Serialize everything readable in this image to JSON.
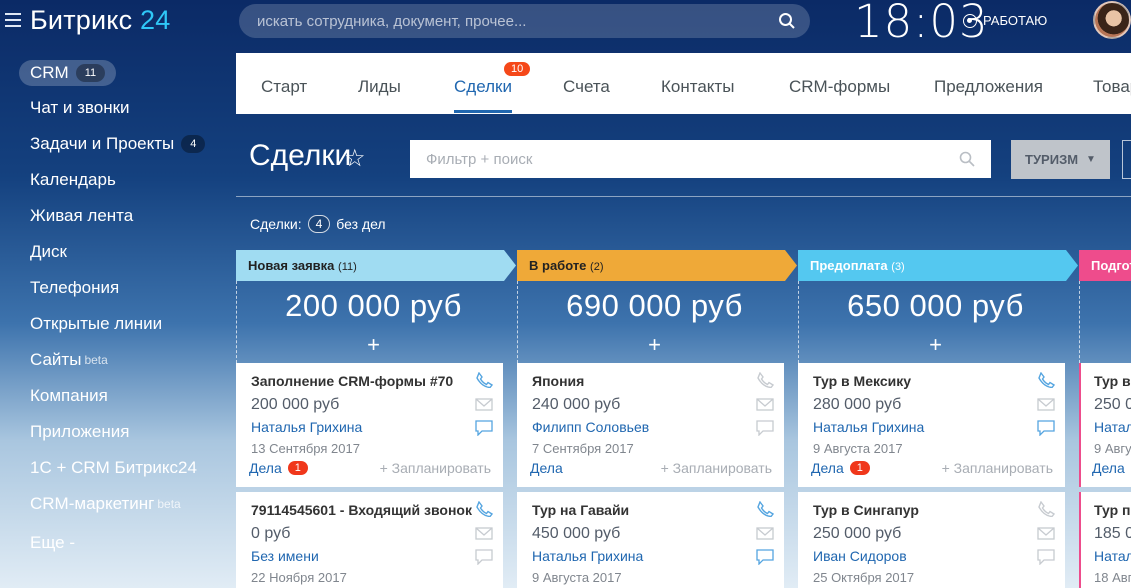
{
  "header": {
    "logo_text": "Битрикс",
    "logo_num": "24",
    "search_placeholder": "искать сотрудника, документ, прочее...",
    "clock": "18:03",
    "status": "РАБОТАЮ"
  },
  "sidebar": {
    "items": [
      {
        "label": "CRM",
        "badge": "11"
      },
      {
        "label": "Чат и звонки"
      },
      {
        "label": "Задачи и Проекты",
        "badge": "4"
      },
      {
        "label": "Календарь"
      },
      {
        "label": "Живая лента"
      },
      {
        "label": "Диск"
      },
      {
        "label": "Телефония"
      },
      {
        "label": "Открытые линии"
      },
      {
        "label": "Сайты",
        "sup": "beta"
      },
      {
        "label": "Компания"
      },
      {
        "label": "Приложения"
      },
      {
        "label": "1С + CRM Битрикс24"
      },
      {
        "label": "CRM-маркетинг",
        "sup": "beta"
      },
      {
        "label": "Еще -"
      }
    ]
  },
  "tabs": [
    {
      "label": "Старт"
    },
    {
      "label": "Лиды"
    },
    {
      "label": "Сделки",
      "badge": "10"
    },
    {
      "label": "Счета"
    },
    {
      "label": "Контакты"
    },
    {
      "label": "CRM-формы"
    },
    {
      "label": "Предложения"
    },
    {
      "label": "Товар"
    }
  ],
  "toolbar": {
    "title": "Сделки",
    "filter_placeholder": "Фильтр + поиск",
    "category": "ТУРИЗМ"
  },
  "summary": {
    "label": "Сделки:",
    "count": "4",
    "suffix": "без дел"
  },
  "columns": [
    {
      "name": "Новая заявка",
      "count": "(11)",
      "total": "200 000 руб",
      "color": "#a0dcf2",
      "cards": [
        {
          "title": "Заполнение CRM-формы #70",
          "amount": "200 000 руб",
          "person": "Наталья Грихина",
          "date": "13 Сентября 2017",
          "deals": "Дела",
          "deals_count": "1",
          "plan": "+ Запланировать"
        },
        {
          "title": "79114545601 - Входящий звонок",
          "amount": "0 руб",
          "person": "Без имени",
          "date": "22 Ноября 2017"
        }
      ]
    },
    {
      "name": "В работе",
      "count": "(2)",
      "total": "690 000 руб",
      "color": "#efa938",
      "cards": [
        {
          "title": "Япония",
          "amount": "240 000 руб",
          "person": "Филипп Соловьев",
          "date": "7 Сентября 2017",
          "deals": "Дела",
          "plan": "+ Запланировать"
        },
        {
          "title": "Тур на Гавайи",
          "amount": "450 000 руб",
          "person": "Наталья Грихина",
          "date": "9 Августа 2017"
        }
      ]
    },
    {
      "name": "Предоплата",
      "count": "(3)",
      "total": "650 000 руб",
      "color": "#54c8f0",
      "cards": [
        {
          "title": "Тур в Мексику",
          "amount": "280 000 руб",
          "person": "Наталья Грихина",
          "date": "9 Августа 2017",
          "deals": "Дела",
          "deals_count": "1",
          "plan": "+ Запланировать"
        },
        {
          "title": "Тур в Сингапур",
          "amount": "250 000 руб",
          "person": "Иван Сидоров",
          "date": "25 Октября 2017"
        }
      ]
    },
    {
      "name": "Подгот",
      "color": "#ee4c8c",
      "cards": [
        {
          "title": "Тур в",
          "amount": "250 0",
          "person": "Натал",
          "date": "9 Авгу",
          "deals": "Дела"
        },
        {
          "title": "Тур по",
          "amount": "185 0",
          "person": "Натал",
          "date": "18 Авг"
        }
      ]
    }
  ]
}
